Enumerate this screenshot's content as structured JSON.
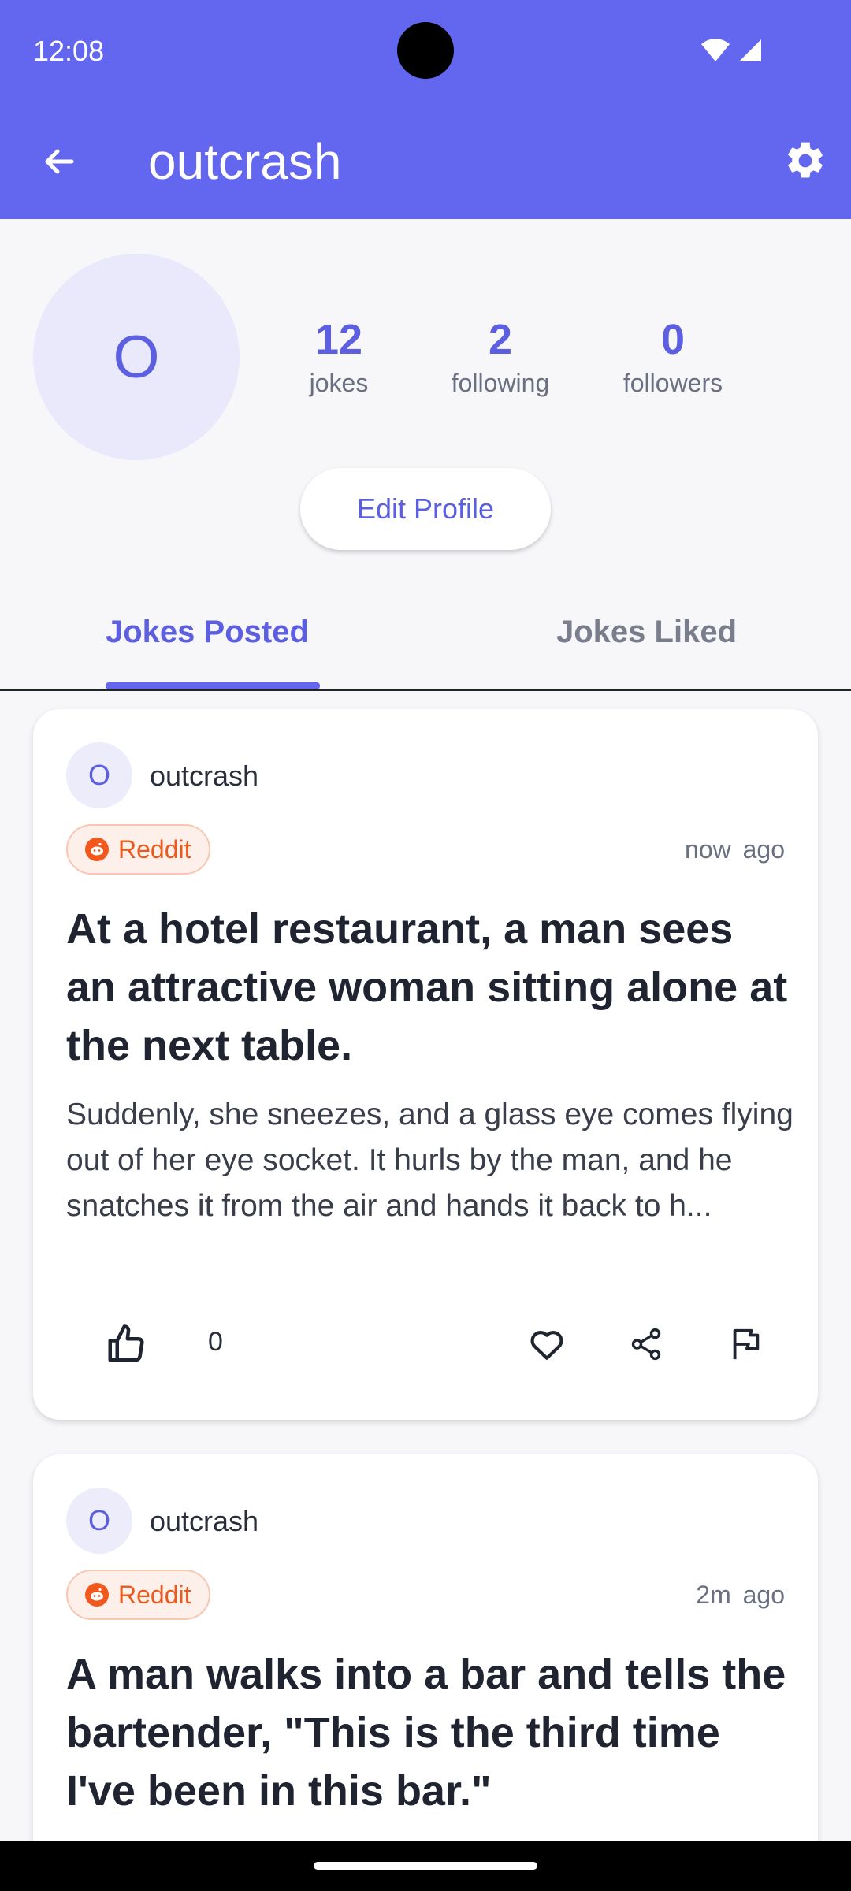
{
  "status_bar": {
    "time": "12:08"
  },
  "header": {
    "title": "outcrash",
    "colors": {
      "background": "#6366ee"
    }
  },
  "profile": {
    "avatar_initial": "O",
    "stats": [
      {
        "value": "12",
        "label": "jokes"
      },
      {
        "value": "2",
        "label": "following"
      },
      {
        "value": "0",
        "label": "followers"
      }
    ],
    "edit_label": "Edit Profile"
  },
  "tabs": [
    {
      "label": "Jokes Posted",
      "active": true
    },
    {
      "label": "Jokes Liked",
      "active": false
    }
  ],
  "jokes": [
    {
      "author_initial": "O",
      "author": "outcrash",
      "source": "Reddit",
      "time": "now ago",
      "title": "At a hotel restaurant, a man sees an attractive woman sitting alone at the next table.",
      "body": "Suddenly, she sneezes, and a glass eye comes flying out of her eye socket. It hurls by the man, and he snatches it from the air and hands it back to h...",
      "likes": "0"
    },
    {
      "author_initial": "O",
      "author": "outcrash",
      "source": "Reddit",
      "time": "2m ago",
      "title": "A man walks into a bar and tells the bartender, \"This is the third time I've been in this bar.\""
    }
  ],
  "icons": {
    "back": "arrow-left-icon",
    "settings": "gear-icon",
    "like": "thumbs-up-icon",
    "favorite": "heart-icon",
    "share": "share-icon",
    "report": "flag-icon"
  }
}
